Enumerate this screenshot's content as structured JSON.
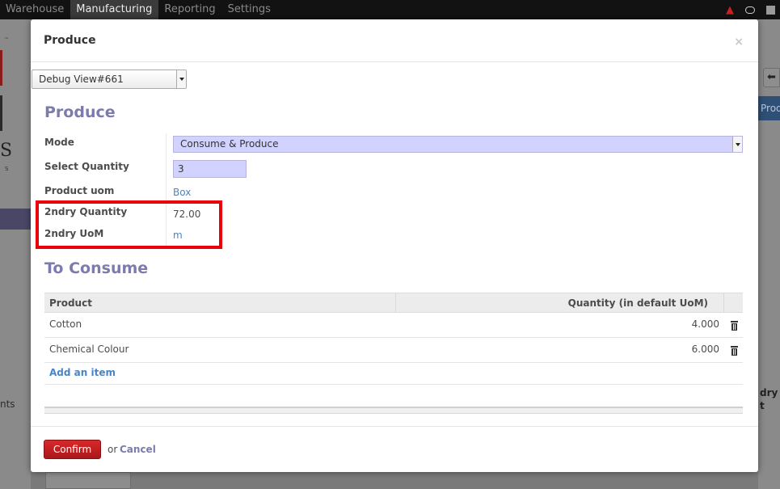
{
  "topbar": {
    "menu": [
      "Warehouse",
      "Manufacturing",
      "Reporting",
      "Settings"
    ],
    "active_index": 1
  },
  "background": {
    "tm": "™",
    "logo_letter": "S",
    "logo_sub": "S",
    "nav_fragment": "nts",
    "back_arrow": "⬅",
    "button_fragment": "Prod",
    "column_fragment_1": "dry",
    "column_fragment_2": "t"
  },
  "modal": {
    "title": "Produce",
    "close": "×",
    "debug_select": "Debug View#661",
    "form": {
      "heading": "Produce",
      "fields": {
        "mode_label": "Mode",
        "mode_value": "Consume & Produce",
        "quantity_label": "Select Quantity",
        "quantity_value": "3",
        "uom_label": "Product uom",
        "uom_value": "Box",
        "secondary_qty_label": "2ndry Quantity",
        "secondary_qty_value": "72.00",
        "secondary_uom_label": "2ndry UoM",
        "secondary_uom_value": "m"
      }
    },
    "consume": {
      "heading": "To Consume",
      "columns": [
        "Product",
        "Quantity (in default UoM)"
      ],
      "rows": [
        {
          "product": "Cotton",
          "quantity": "4.000"
        },
        {
          "product": "Chemical Colour",
          "quantity": "6.000"
        }
      ],
      "add_item": "Add an item"
    },
    "footer": {
      "confirm": "Confirm",
      "or": "or",
      "cancel": "Cancel"
    }
  },
  "colors": {
    "accent": "#7c7bad",
    "link": "#4a84c6",
    "highlight": "#e8000a",
    "confirm": "#c21f21",
    "input_bg": "#d2d2ff"
  }
}
